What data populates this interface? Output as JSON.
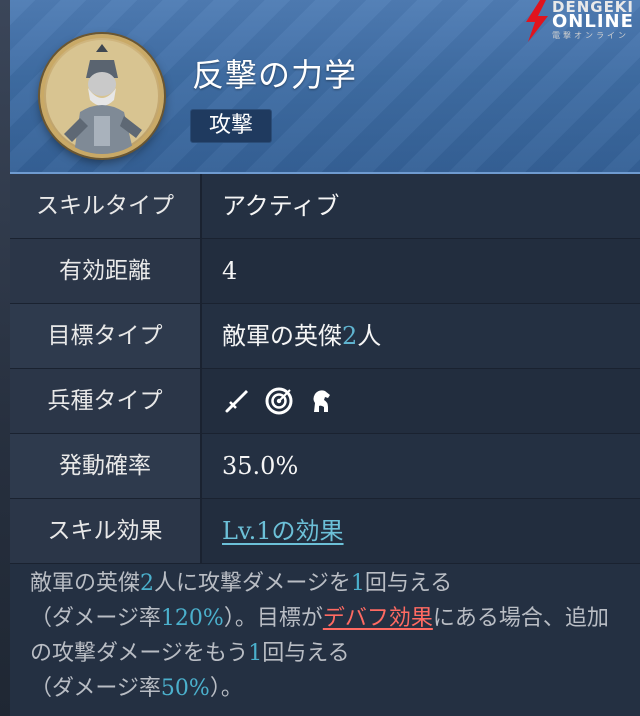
{
  "brand": {
    "line1": "DENGEKI",
    "line2": "ONLINE",
    "line3": "電撃オンライン"
  },
  "skill": {
    "name": "反撃の力学",
    "tag": "攻撃"
  },
  "rows": [
    {
      "label": "スキルタイプ",
      "value": "アクティブ"
    },
    {
      "label": "有効距離",
      "value": "4"
    },
    {
      "label": "目標タイプ",
      "value_prefix": "敵軍の英傑",
      "value_num": "2",
      "value_suffix": "人"
    },
    {
      "label": "兵種タイプ",
      "icons": [
        "sword-icon",
        "bow-target-icon",
        "horse-icon"
      ]
    },
    {
      "label": "発動確率",
      "value": "35.0%"
    },
    {
      "label": "スキル効果",
      "value": "Lv.1の効果"
    }
  ],
  "description": {
    "p1": "敵軍の英傑",
    "n1": "2",
    "p2": "人に攻撃ダメージを",
    "n2": "1",
    "p3": "回与える",
    "p4": "（ダメージ率",
    "n3": "120%",
    "p5": "）。目標が",
    "debuff": "デバフ効果",
    "p6": "にある場合、追加の攻撃ダメージをもう",
    "n4": "1",
    "p7": "回与える",
    "p8": "（ダメージ率",
    "n5": "50%",
    "p9": "）。"
  },
  "colors": {
    "header": "#4674ab",
    "accent": "#5fb3cf",
    "debuff": "#ff6a62"
  }
}
